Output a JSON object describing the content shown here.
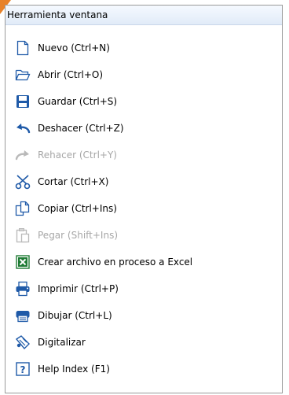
{
  "window": {
    "title": "Herramienta ventana"
  },
  "menu": {
    "items": [
      {
        "label": "Nuevo (Ctrl+N)",
        "icon": "new-document-icon",
        "enabled": true
      },
      {
        "label": "Abrir (Ctrl+O)",
        "icon": "open-folder-icon",
        "enabled": true
      },
      {
        "label": "Guardar (Ctrl+S)",
        "icon": "save-disk-icon",
        "enabled": true
      },
      {
        "label": "Deshacer (Ctrl+Z)",
        "icon": "undo-icon",
        "enabled": true
      },
      {
        "label": "Rehacer (Ctrl+Y)",
        "icon": "redo-icon",
        "enabled": false
      },
      {
        "label": "Cortar (Ctrl+X)",
        "icon": "scissors-icon",
        "enabled": true
      },
      {
        "label": "Copiar (Ctrl+Ins)",
        "icon": "copy-icon",
        "enabled": true
      },
      {
        "label": "Pegar (Shift+Ins)",
        "icon": "paste-icon",
        "enabled": false
      },
      {
        "label": "Crear archivo en proceso a Excel",
        "icon": "excel-icon",
        "enabled": true
      },
      {
        "label": "Imprimir (Ctrl+P)",
        "icon": "printer-icon",
        "enabled": true
      },
      {
        "label": "Dibujar (Ctrl+L)",
        "icon": "plotter-icon",
        "enabled": true
      },
      {
        "label": "Digitalizar",
        "icon": "digitize-icon",
        "enabled": true
      },
      {
        "label": "Help Index (F1)",
        "icon": "help-icon",
        "enabled": true
      }
    ]
  },
  "colors": {
    "accent": "#e8822a",
    "icon_blue": "#1f5aa8",
    "disabled_text": "#a7a7a7",
    "excel_green": "#1e7b34"
  }
}
